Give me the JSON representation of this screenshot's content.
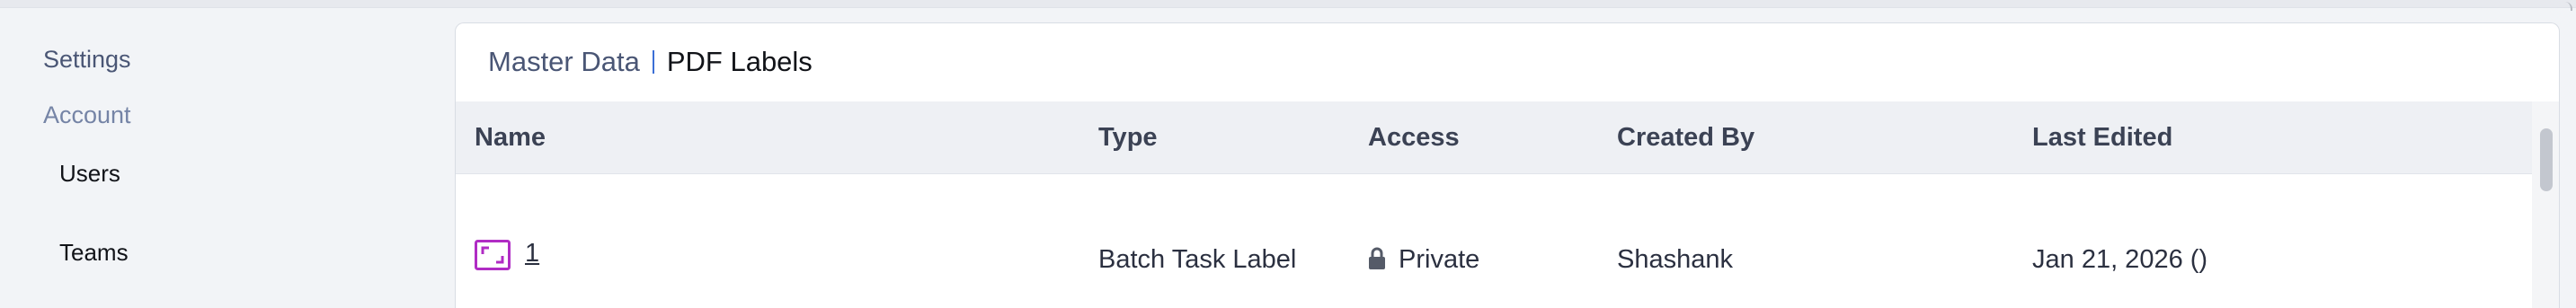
{
  "sidebar": {
    "settings_label": "Settings",
    "account_label": "Account",
    "items": [
      {
        "label": "Users"
      },
      {
        "label": "Teams"
      }
    ]
  },
  "breadcrumb": {
    "parent": "Master Data",
    "current": "PDF Labels"
  },
  "table": {
    "columns": [
      "Name",
      "Type",
      "Access",
      "Created By",
      "Last Edited"
    ],
    "rows": [
      {
        "name": "1",
        "type": "Batch Task Label",
        "access": "Private",
        "created_by": "Shashank",
        "last_edited": "Jan 21, 2026 ()"
      }
    ]
  },
  "icons": {
    "label_icon": "pdf-label-icon",
    "lock_icon": "lock-icon"
  },
  "colors": {
    "label_icon": "#b02cc4",
    "breadcrumb_separator": "#3b6fd6",
    "header_bg": "#eef0f4"
  }
}
